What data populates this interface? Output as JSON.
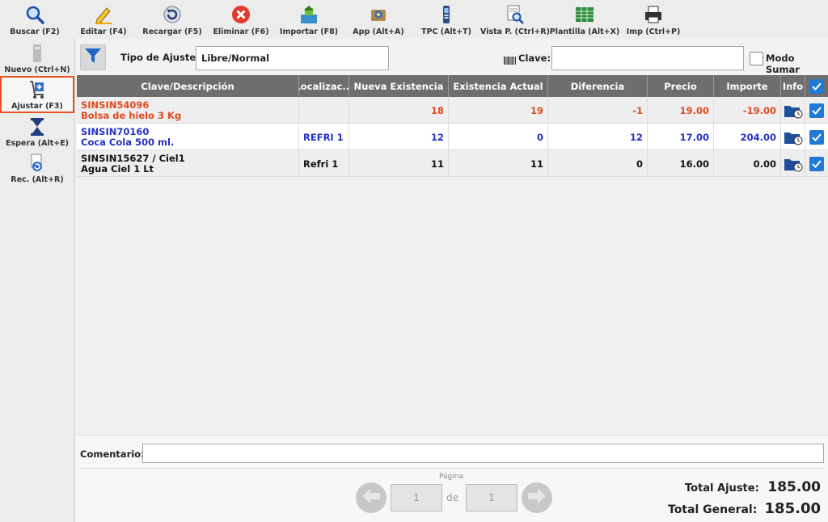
{
  "toolbar": {
    "buscar": "Buscar (F2)",
    "editar": "Editar (F4)",
    "recargar": "Recargar (F5)",
    "eliminar": "Eliminar (F6)",
    "importar": "Importar (F8)",
    "app": "App (Alt+A)",
    "tpc": "TPC (Alt+T)",
    "vista": "Vista P. (Ctrl+R)",
    "plantilla": "Plantilla (Alt+X)",
    "imp": "Imp (Ctrl+P)"
  },
  "sidebar": {
    "nuevo": "Nuevo (Ctrl+N)",
    "ajustar": "Ajustar (F3)",
    "espera": "Espera (Alt+E)",
    "rec": "Rec. (Alt+R)"
  },
  "filters": {
    "tipo_label": "Tipo de Ajuste:",
    "tipo_value": "Libre/Normal",
    "clave_label": "Clave:",
    "clave_value": "",
    "modo_sumar": "Modo Sumar"
  },
  "table": {
    "headers": [
      "Clave/Descripción",
      "Localizac...",
      "Nueva Existencia",
      "Existencia Actual",
      "Diferencia",
      "Precio",
      "Importe",
      "Info"
    ],
    "rows": [
      {
        "clave": "SINSIN54096",
        "desc": "Bolsa de hielo 3 Kg",
        "loc": "",
        "nueva": "18",
        "actual": "19",
        "dif": "-1",
        "precio": "19.00",
        "importe": "-19.00",
        "checked": true
      },
      {
        "clave": "SINSIN70160",
        "desc": "Coca Cola 500 ml.",
        "loc": "REFRI 1",
        "nueva": "12",
        "actual": "0",
        "dif": "12",
        "precio": "17.00",
        "importe": "204.00",
        "checked": true
      },
      {
        "clave": "SINSIN15627 / Ciel1",
        "desc": "Agua Ciel 1 Lt",
        "loc": "Refri 1",
        "nueva": "11",
        "actual": "11",
        "dif": "0",
        "precio": "16.00",
        "importe": "0.00",
        "checked": true
      }
    ]
  },
  "bottom": {
    "comentario_label": "Comentario:",
    "comentario_value": "",
    "pagina_label": "Página",
    "page_current": "1",
    "de_label": "de",
    "page_total": "1",
    "total_ajuste_label": "Total Ajuste:",
    "total_ajuste_value": "185.00",
    "total_general_label": "Total General:",
    "total_general_value": "185.00"
  },
  "colors": {
    "accent_blue": "#1f7ad6",
    "row_red": "#e24a1e",
    "row_blue": "#2430c7",
    "active_border": "#e8531f"
  }
}
